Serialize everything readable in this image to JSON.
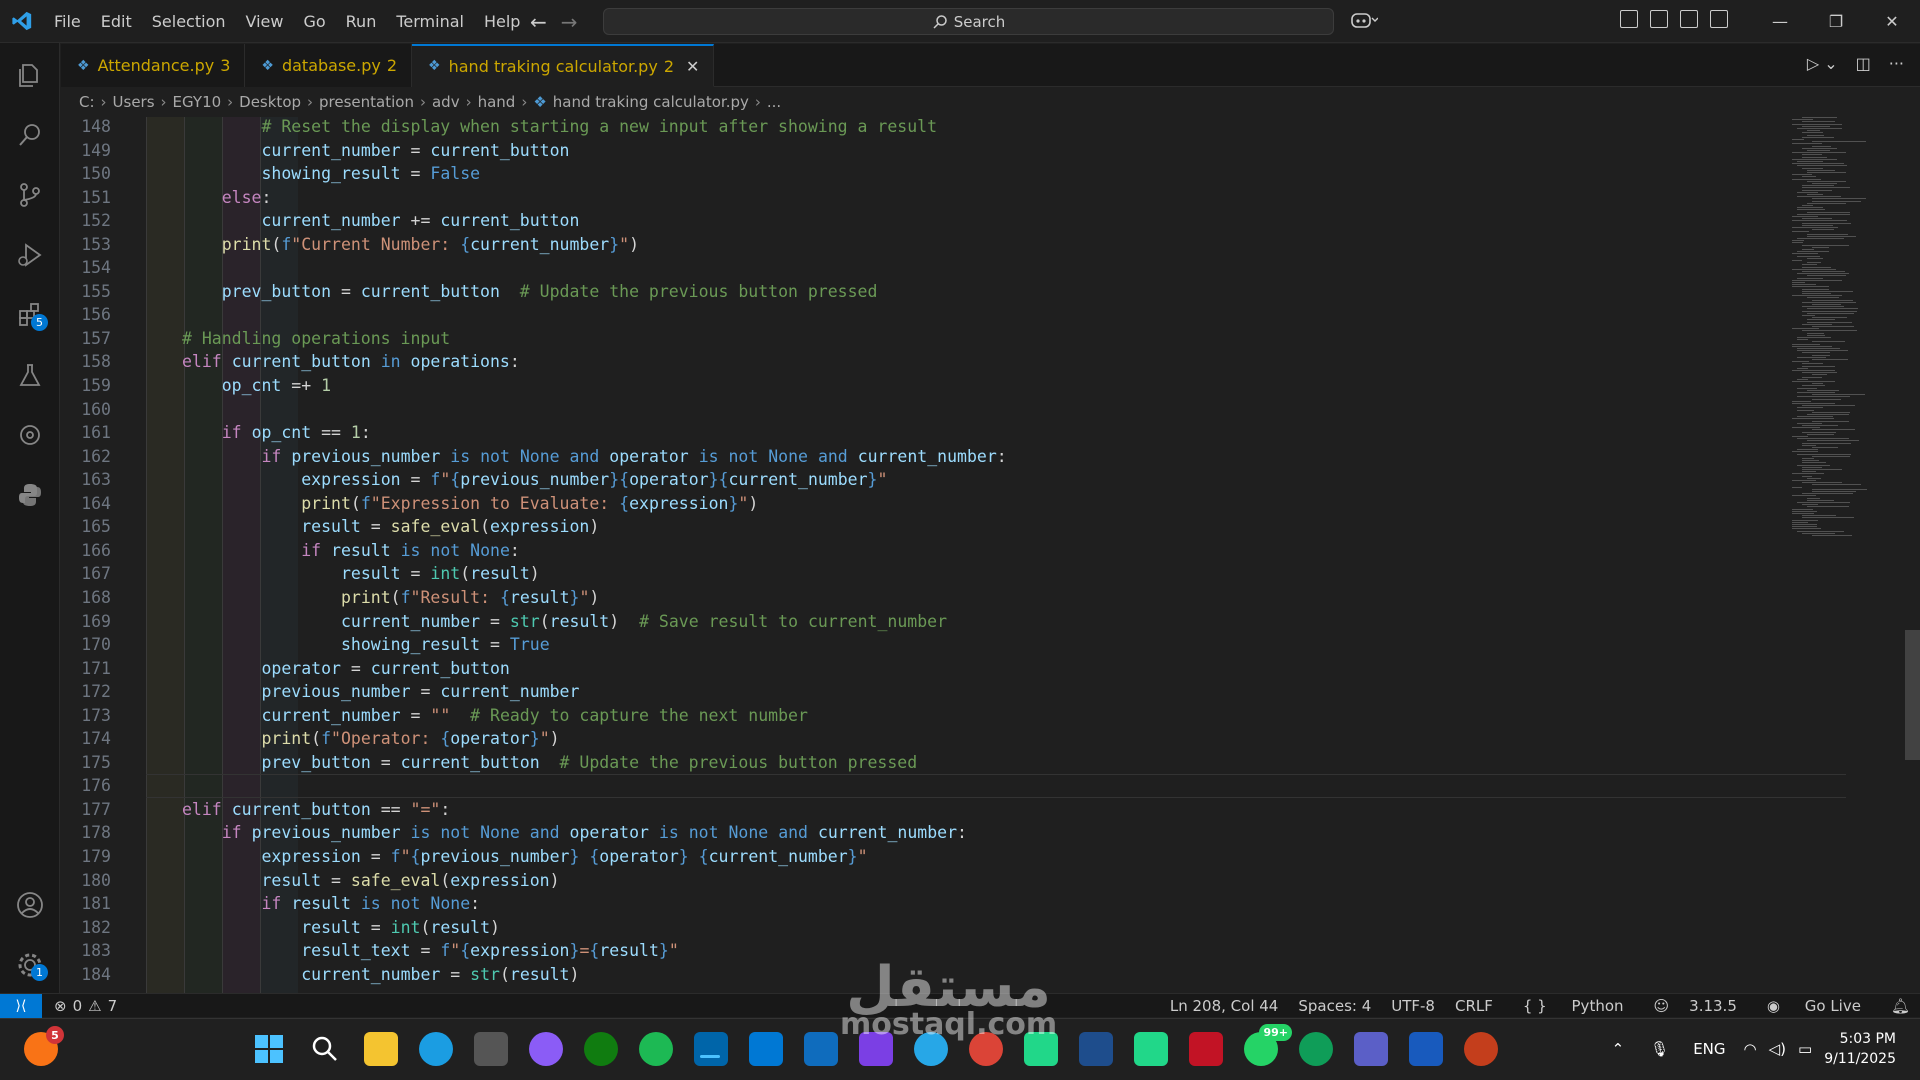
{
  "menu": [
    "File",
    "Edit",
    "Selection",
    "View",
    "Go",
    "Run",
    "Terminal",
    "Help"
  ],
  "search": {
    "placeholder": "Search"
  },
  "tabs": [
    {
      "label": "Attendance.py",
      "count": "3"
    },
    {
      "label": "database.py",
      "count": "2"
    },
    {
      "label": "hand traking calculator.py",
      "count": "2",
      "active": true
    }
  ],
  "breadcrumb": [
    "C:",
    "Users",
    "EGY10",
    "Desktop",
    "presentation",
    "adv",
    "hand",
    "hand traking calculator.py",
    "..."
  ],
  "activity_badges": {
    "extensions": "5",
    "settings": "1"
  },
  "code_lines": [
    {
      "n": "148",
      "text": "        # Reset the display when starting a new input after showing a result"
    },
    {
      "n": "149",
      "text": "        current_number = current_button"
    },
    {
      "n": "150",
      "text": "        showing_result = False"
    },
    {
      "n": "151",
      "text": "    else:"
    },
    {
      "n": "152",
      "text": "        current_number += current_button"
    },
    {
      "n": "153",
      "text": "    print(f\"Current Number: {current_number}\")"
    },
    {
      "n": "154",
      "text": ""
    },
    {
      "n": "155",
      "text": "    prev_button = current_button  # Update the previous button pressed"
    },
    {
      "n": "156",
      "text": ""
    },
    {
      "n": "157",
      "text": "# Handling operations input"
    },
    {
      "n": "158",
      "text": "elif current_button in operations:"
    },
    {
      "n": "159",
      "text": "    op_cnt =+ 1"
    },
    {
      "n": "160",
      "text": ""
    },
    {
      "n": "161",
      "text": "    if op_cnt == 1:"
    },
    {
      "n": "162",
      "text": "        if previous_number is not None and operator is not None and current_number:"
    },
    {
      "n": "163",
      "text": "            expression = f\"{previous_number}{operator}{current_number}\""
    },
    {
      "n": "164",
      "text": "            print(f\"Expression to Evaluate: {expression}\")"
    },
    {
      "n": "165",
      "text": "            result = safe_eval(expression)"
    },
    {
      "n": "166",
      "text": "            if result is not None:"
    },
    {
      "n": "167",
      "text": "                result = int(result)"
    },
    {
      "n": "168",
      "text": "                print(f\"Result: {result}\")"
    },
    {
      "n": "169",
      "text": "                current_number = str(result)  # Save result to current_number"
    },
    {
      "n": "170",
      "text": "                showing_result = True"
    },
    {
      "n": "171",
      "text": "        operator = current_button"
    },
    {
      "n": "172",
      "text": "        previous_number = current_number"
    },
    {
      "n": "173",
      "text": "        current_number = \"\"  # Ready to capture the next number"
    },
    {
      "n": "174",
      "text": "        print(f\"Operator: {operator}\")"
    },
    {
      "n": "175",
      "text": "        prev_button = current_button  # Update the previous button pressed"
    },
    {
      "n": "176",
      "text": ""
    },
    {
      "n": "177",
      "text": "elif current_button == \"=\":"
    },
    {
      "n": "178",
      "text": "    if previous_number is not None and operator is not None and current_number:"
    },
    {
      "n": "179",
      "text": "        expression = f\"{previous_number} {operator} {current_number}\""
    },
    {
      "n": "180",
      "text": "        result = safe_eval(expression)"
    },
    {
      "n": "181",
      "text": "        if result is not None:"
    },
    {
      "n": "182",
      "text": "            result = int(result)"
    },
    {
      "n": "183",
      "text": "            result_text = f\"{expression}={result}\""
    },
    {
      "n": "184",
      "text": "            current_number = str(result)"
    }
  ],
  "status": {
    "errors": "0",
    "warnings": "7",
    "cursor": "Ln 208, Col 44",
    "spaces": "Spaces: 4",
    "encoding": "UTF-8",
    "eol": "CRLF",
    "language": "Python",
    "python_version": "3.13.5",
    "go_live": "Go Live"
  },
  "taskbar": {
    "notif_badge": "5",
    "whatsapp_badge": "99+",
    "lang": "ENG",
    "time": "5:03 PM",
    "date": "9/11/2025"
  },
  "watermark": {
    "arabic": "مستقل",
    "latin": "mostaql.com"
  },
  "colors": {
    "accent": "#0078d4",
    "keyword": "#c586c0",
    "variable": "#9cdcfe",
    "string": "#ce9178",
    "comment": "#6a9955",
    "function": "#dcdcaa",
    "constant": "#569cd6"
  }
}
